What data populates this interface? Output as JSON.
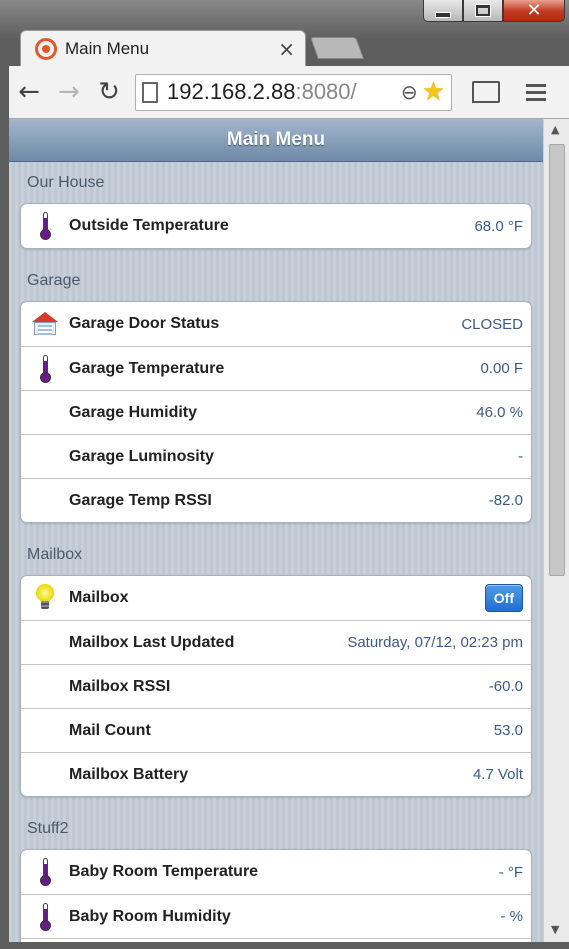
{
  "window": {
    "controls": {
      "minimize": "",
      "maximize": "",
      "close": "✕"
    }
  },
  "tab": {
    "title": "Main Menu",
    "close_glyph": "×"
  },
  "toolbar": {
    "back_glyph": "←",
    "forward_glyph": "→",
    "reload_glyph": "↻",
    "url_host": "192.168.2.88",
    "url_rest": ":8080/",
    "zoom_glyph": "⊖",
    "star_glyph": "★"
  },
  "page": {
    "header_title": "Main Menu",
    "sections": [
      {
        "label": "Our House",
        "rows": [
          {
            "icon": "thermometer-icon",
            "label": "Outside Temperature",
            "value": "68.0 °F"
          }
        ]
      },
      {
        "label": "Garage",
        "rows": [
          {
            "icon": "garage-icon",
            "label": "Garage Door Status",
            "value": "CLOSED"
          },
          {
            "icon": "thermometer-icon",
            "label": "Garage Temperature",
            "value": "0.00 F"
          },
          {
            "icon": "",
            "label": "Garage Humidity",
            "value": "46.0 %"
          },
          {
            "icon": "",
            "label": "Garage Luminosity",
            "value": "-"
          },
          {
            "icon": "",
            "label": "Garage Temp RSSI",
            "value": "-82.0"
          }
        ]
      },
      {
        "label": "Mailbox",
        "rows": [
          {
            "icon": "lightbulb-icon",
            "label": "Mailbox",
            "value": "",
            "toggle": "Off"
          },
          {
            "icon": "",
            "label": "Mailbox Last Updated",
            "value": "Saturday, 07/12, 02:23 pm"
          },
          {
            "icon": "",
            "label": "Mailbox RSSI",
            "value": "-60.0"
          },
          {
            "icon": "",
            "label": "Mail Count",
            "value": "53.0"
          },
          {
            "icon": "",
            "label": "Mailbox Battery",
            "value": "4.7 Volt"
          }
        ]
      },
      {
        "label": "Stuff2",
        "rows": [
          {
            "icon": "thermometer-icon",
            "label": "Baby Room Temperature",
            "value": "- °F"
          },
          {
            "icon": "thermometer-icon",
            "label": "Baby Room Humidity",
            "value": "- %"
          },
          {
            "icon": "",
            "label": "",
            "value": ""
          }
        ]
      }
    ]
  },
  "scrollbar": {
    "up_glyph": "▲",
    "down_glyph": "▼"
  },
  "colors": {
    "header_bar": "#6e8aa8",
    "value_text": "#3d5b8a",
    "toggle_button": "#1f6fd0",
    "close_button": "#c2381f"
  }
}
